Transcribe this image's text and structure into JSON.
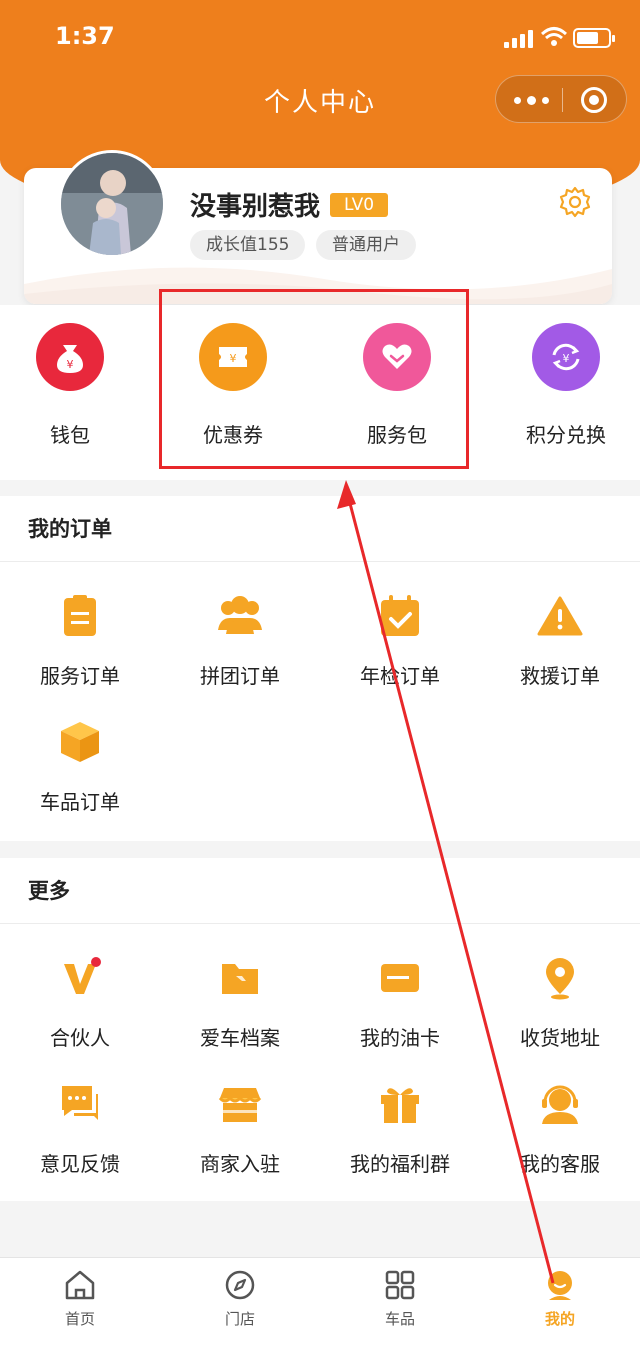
{
  "status": {
    "time": "1:37"
  },
  "header": {
    "title": "个人中心"
  },
  "profile": {
    "username": "没事别惹我",
    "level": "LV0",
    "growth": "成长值155",
    "user_type": "普通用户"
  },
  "quick": [
    {
      "label": "钱包",
      "icon": "money-bag-icon"
    },
    {
      "label": "优惠券",
      "icon": "coupon-icon"
    },
    {
      "label": "服务包",
      "icon": "heart-icon"
    },
    {
      "label": "积分兑换",
      "icon": "exchange-icon"
    }
  ],
  "orders": {
    "title": "我的订单",
    "items": [
      {
        "label": "服务订单",
        "icon": "clipboard-icon"
      },
      {
        "label": "拼团订单",
        "icon": "group-icon"
      },
      {
        "label": "年检订单",
        "icon": "calendar-check-icon"
      },
      {
        "label": "救援订单",
        "icon": "warning-icon"
      },
      {
        "label": "车品订单",
        "icon": "box-icon"
      }
    ]
  },
  "more": {
    "title": "更多",
    "items": [
      {
        "label": "合伙人",
        "icon": "v-partner-icon"
      },
      {
        "label": "爱车档案",
        "icon": "folder-icon"
      },
      {
        "label": "我的油卡",
        "icon": "card-icon"
      },
      {
        "label": "收货地址",
        "icon": "location-pin-icon"
      },
      {
        "label": "意见反馈",
        "icon": "chat-bubble-icon"
      },
      {
        "label": "商家入驻",
        "icon": "store-icon"
      },
      {
        "label": "我的福利群",
        "icon": "gift-icon"
      },
      {
        "label": "我的客服",
        "icon": "headset-icon"
      }
    ]
  },
  "tabs": [
    {
      "label": "首页",
      "icon": "home-icon"
    },
    {
      "label": "门店",
      "icon": "compass-icon"
    },
    {
      "label": "车品",
      "icon": "grid-icon"
    },
    {
      "label": "我的",
      "icon": "user-icon"
    }
  ],
  "colors": {
    "brand": "#ee7f1c",
    "accent": "#f5a524",
    "wallet": "#e8283c",
    "coupon": "#f59a1b",
    "service": "#f0589a",
    "points": "#a25ae6",
    "annotation": "#e8282a"
  }
}
